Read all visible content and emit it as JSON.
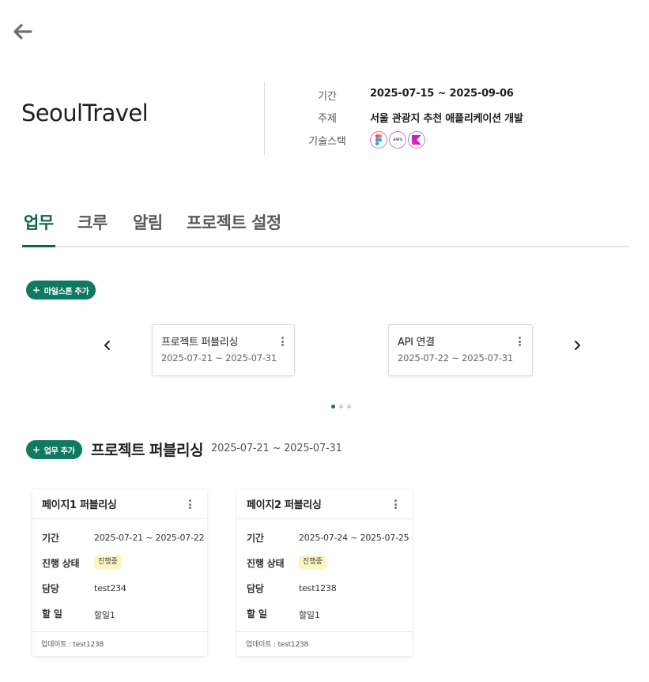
{
  "header": {
    "project_name": "SeoulTravel",
    "info": {
      "period_label": "기간",
      "period_value": "2025-07-15 ~ 2025-09-06",
      "topic_label": "주제",
      "topic_value": "서울 관광지 추천 애플리케이션 개발",
      "tech_label": "기술스택",
      "tech_stack": [
        {
          "name": "figma-icon"
        },
        {
          "name": "aws-icon",
          "text": "aws"
        },
        {
          "name": "kotlin-icon"
        }
      ]
    }
  },
  "tabs": [
    "업무",
    "크루",
    "알림",
    "프로젝트 설정"
  ],
  "active_tab": "업무",
  "colors": {
    "accent": "#0f7a5f",
    "accent_dark": "#0d6650",
    "badge_bg": "#fdf6c3"
  },
  "milestones": {
    "add_button": "마일스톤 추가",
    "cards": [
      {
        "title": "프로젝트 퍼블리싱",
        "date": "2025-07-21 ~ 2025-07-31"
      },
      {
        "title": "API 연결",
        "date": "2025-07-22 ~ 2025-07-31"
      }
    ],
    "pages": 3,
    "current_page": 1
  },
  "tasks_section": {
    "add_button": "업무 추가",
    "milestone_title": "프로젝트 퍼블리싱",
    "milestone_date": "2025-07-21 ~ 2025-07-31",
    "labels": {
      "period": "기간",
      "status": "진행 상태",
      "assignee": "담당",
      "todo": "할 일"
    },
    "tasks": [
      {
        "title": "페이지1 퍼블리싱",
        "period": "2025-07-21 ~ 2025-07-22",
        "status": "진행중",
        "assignee": "test234",
        "todo": "할일1",
        "updated": "업데이트 : test1238"
      },
      {
        "title": "페이지2 퍼블리싱",
        "period": "2025-07-24 ~ 2025-07-25",
        "status": "진행중",
        "assignee": "test1238",
        "todo": "할일1",
        "updated": "업데이트 : test1238"
      }
    ]
  }
}
